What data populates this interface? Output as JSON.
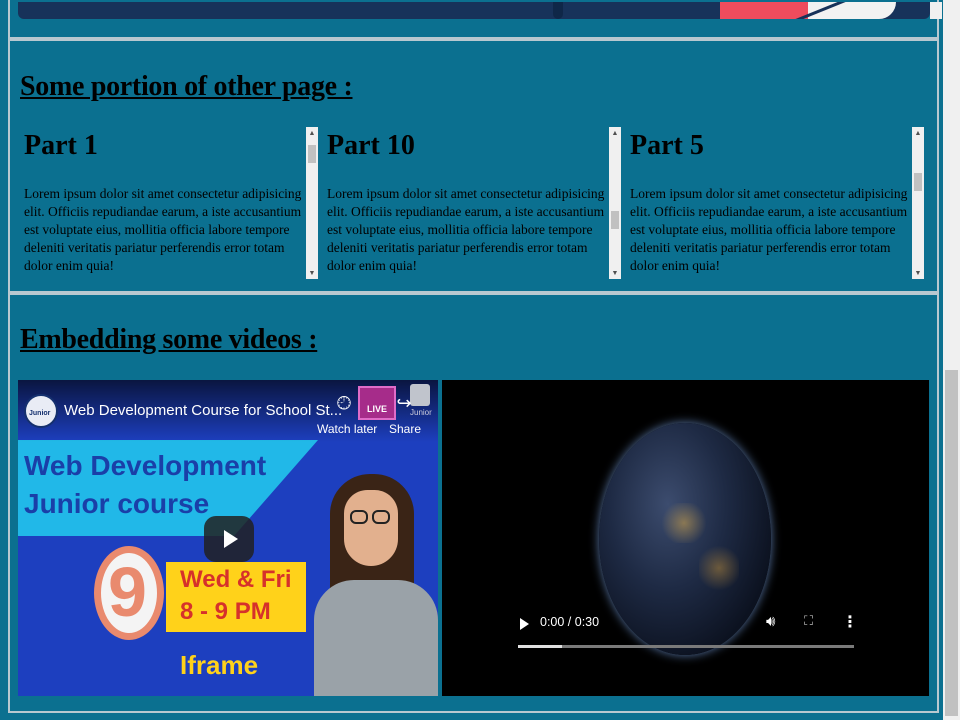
{
  "sections": {
    "other_page_title": "Some portion of other page :",
    "videos_title": "Embedding some videos :"
  },
  "parts": [
    {
      "title": "Part 1",
      "text": "Lorem ipsum dolor sit amet consectetur adipisicing elit. Officiis repudiandae earum, a iste accusantium est voluptate eius, mollitia officia labore tempore deleniti veritatis pariatur perferendis error totam dolor enim quia!"
    },
    {
      "title": "Part 10",
      "text": "Lorem ipsum dolor sit amet consectetur adipisicing elit. Officiis repudiandae earum, a iste accusantium est voluptate eius, mollitia officia labore tempore deleniti veritatis pariatur perferendis error totam dolor enim quia!"
    },
    {
      "title": "Part 5",
      "text": "Lorem ipsum dolor sit amet consectetur adipisicing elit. Officiis repudiandae earum, a iste accusantium est voluptate eius, mollitia officia labore tempore deleniti veritatis pariatur perferendis error totam dolor enim quia!"
    }
  ],
  "youtube": {
    "video_title": "Web Development Course for School St...",
    "watch_later": "Watch later",
    "share": "Share",
    "live_badge": "LIVE",
    "channel_small": "Junior",
    "logo_text": "Junior",
    "thumb_line1": "Web Development",
    "thumb_line2": "Junior course",
    "thumb_number": "9",
    "thumb_days": "Wed & Fri",
    "thumb_time": "8 - 9 PM",
    "thumb_label": "Iframe"
  },
  "video_player": {
    "time": "0:00 / 0:30",
    "progress": 0.13
  },
  "colors": {
    "page_bg": "#0b7090",
    "accent_red": "#ef4c5d"
  }
}
